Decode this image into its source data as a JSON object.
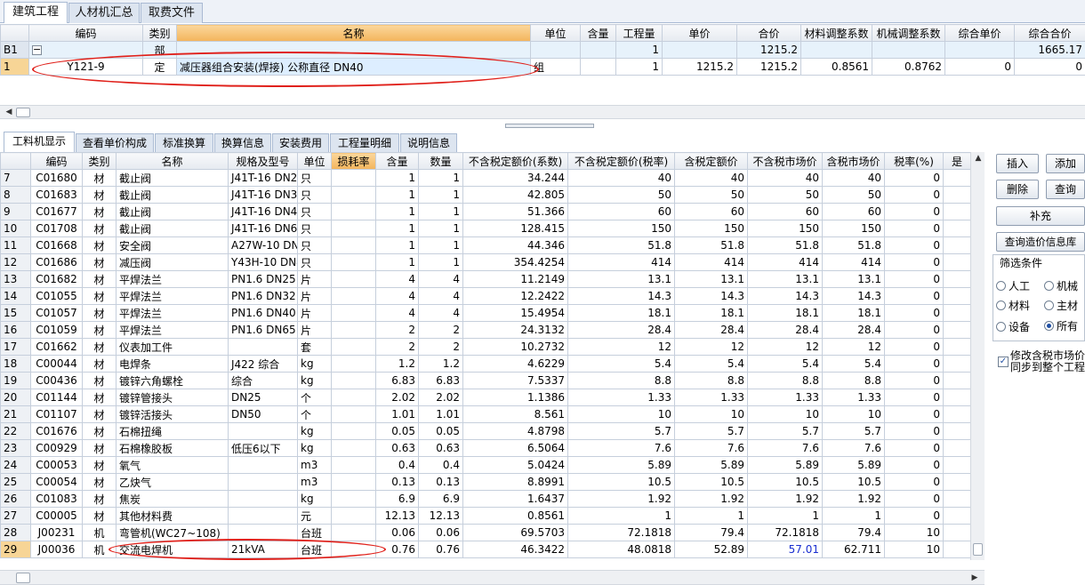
{
  "top_tabs": [
    "建筑工程",
    "人材机汇总",
    "取费文件"
  ],
  "upper_table": {
    "headers": [
      "编码",
      "类别",
      "名称",
      "单位",
      "含量",
      "工程量",
      "单价",
      "合价",
      "材料调整系数",
      "机械调整系数",
      "综合单价",
      "综合合价"
    ],
    "rows": [
      {
        "rh": "B1",
        "code": "",
        "type": "部",
        "name": "",
        "unit": "",
        "content": "",
        "qty": "1",
        "price": "",
        "total": "1215.2",
        "mat_coef": "",
        "mach_coef": "",
        "unit_total": "",
        "sum_total": "1665.17"
      },
      {
        "rh": "1",
        "code": "Y121-9",
        "type": "定",
        "name": "减压器组合安装(焊接) 公称直径 DN40",
        "unit": "组",
        "content": "",
        "qty": "1",
        "price": "1215.2",
        "total": "1215.2",
        "mat_coef": "0.8561",
        "mach_coef": "0.8762",
        "unit_total": "0",
        "sum_total": "0"
      }
    ],
    "expander_symbol": "−"
  },
  "bottom_tabs": [
    "工料机显示",
    "查看单价构成",
    "标准换算",
    "换算信息",
    "安装费用",
    "工程量明细",
    "说明信息"
  ],
  "lower_table": {
    "headers": [
      "编码",
      "类别",
      "名称",
      "规格及型号",
      "单位",
      "损耗率",
      "含量",
      "数量",
      "不含税定额价(系数)",
      "不含税定额价(税率)",
      "含税定额价",
      "不含税市场价",
      "含税市场价",
      "税率(%)",
      "是"
    ],
    "rows": [
      [
        "7",
        "C01680",
        "材",
        "截止阀",
        "J41T-16 DN2",
        "只",
        "",
        "1",
        "1",
        "34.244",
        "40",
        "40",
        "40",
        "40",
        "0"
      ],
      [
        "8",
        "C01683",
        "材",
        "截止阀",
        "J41T-16 DN3",
        "只",
        "",
        "1",
        "1",
        "42.805",
        "50",
        "50",
        "50",
        "50",
        "0"
      ],
      [
        "9",
        "C01677",
        "材",
        "截止阀",
        "J41T-16 DN4",
        "只",
        "",
        "1",
        "1",
        "51.366",
        "60",
        "60",
        "60",
        "60",
        "0"
      ],
      [
        "10",
        "C01708",
        "材",
        "截止阀",
        "J41T-16 DN6",
        "只",
        "",
        "1",
        "1",
        "128.415",
        "150",
        "150",
        "150",
        "150",
        "0"
      ],
      [
        "11",
        "C01668",
        "材",
        "安全阀",
        "A27W-10 DN4",
        "只",
        "",
        "1",
        "1",
        "44.346",
        "51.8",
        "51.8",
        "51.8",
        "51.8",
        "0"
      ],
      [
        "12",
        "C01686",
        "材",
        "减压阀",
        "Y43H-10 DN4",
        "只",
        "",
        "1",
        "1",
        "354.4254",
        "414",
        "414",
        "414",
        "414",
        "0"
      ],
      [
        "13",
        "C01682",
        "材",
        "平焊法兰",
        "PN1.6 DN25",
        "片",
        "",
        "4",
        "4",
        "11.2149",
        "13.1",
        "13.1",
        "13.1",
        "13.1",
        "0"
      ],
      [
        "14",
        "C01055",
        "材",
        "平焊法兰",
        "PN1.6 DN32",
        "片",
        "",
        "4",
        "4",
        "12.2422",
        "14.3",
        "14.3",
        "14.3",
        "14.3",
        "0"
      ],
      [
        "15",
        "C01057",
        "材",
        "平焊法兰",
        "PN1.6 DN40",
        "片",
        "",
        "4",
        "4",
        "15.4954",
        "18.1",
        "18.1",
        "18.1",
        "18.1",
        "0"
      ],
      [
        "16",
        "C01059",
        "材",
        "平焊法兰",
        "PN1.6 DN65",
        "片",
        "",
        "2",
        "2",
        "24.3132",
        "28.4",
        "28.4",
        "28.4",
        "28.4",
        "0"
      ],
      [
        "17",
        "C01662",
        "材",
        "仪表加工件",
        "",
        "套",
        "",
        "2",
        "2",
        "10.2732",
        "12",
        "12",
        "12",
        "12",
        "0"
      ],
      [
        "18",
        "C00044",
        "材",
        "电焊条",
        "J422 综合",
        "kg",
        "",
        "1.2",
        "1.2",
        "4.6229",
        "5.4",
        "5.4",
        "5.4",
        "5.4",
        "0"
      ],
      [
        "19",
        "C00436",
        "材",
        "镀锌六角螺栓",
        "综合",
        "kg",
        "",
        "6.83",
        "6.83",
        "7.5337",
        "8.8",
        "8.8",
        "8.8",
        "8.8",
        "0"
      ],
      [
        "20",
        "C01144",
        "材",
        "镀锌管接头",
        "DN25",
        "个",
        "",
        "2.02",
        "2.02",
        "1.1386",
        "1.33",
        "1.33",
        "1.33",
        "1.33",
        "0"
      ],
      [
        "21",
        "C01107",
        "材",
        "镀锌活接头",
        "DN50",
        "个",
        "",
        "1.01",
        "1.01",
        "8.561",
        "10",
        "10",
        "10",
        "10",
        "0"
      ],
      [
        "22",
        "C01676",
        "材",
        "石棉扭绳",
        "",
        "kg",
        "",
        "0.05",
        "0.05",
        "4.8798",
        "5.7",
        "5.7",
        "5.7",
        "5.7",
        "0"
      ],
      [
        "23",
        "C00929",
        "材",
        "石棉橡胶板",
        "低压6以下",
        "kg",
        "",
        "0.63",
        "0.63",
        "6.5064",
        "7.6",
        "7.6",
        "7.6",
        "7.6",
        "0"
      ],
      [
        "24",
        "C00053",
        "材",
        "氧气",
        "",
        "m3",
        "",
        "0.4",
        "0.4",
        "5.0424",
        "5.89",
        "5.89",
        "5.89",
        "5.89",
        "0"
      ],
      [
        "25",
        "C00054",
        "材",
        "乙炔气",
        "",
        "m3",
        "",
        "0.13",
        "0.13",
        "8.8991",
        "10.5",
        "10.5",
        "10.5",
        "10.5",
        "0"
      ],
      [
        "26",
        "C01083",
        "材",
        "焦炭",
        "",
        "kg",
        "",
        "6.9",
        "6.9",
        "1.6437",
        "1.92",
        "1.92",
        "1.92",
        "1.92",
        "0"
      ],
      [
        "27",
        "C00005",
        "材",
        "其他材料费",
        "",
        "元",
        "",
        "12.13",
        "12.13",
        "0.8561",
        "1",
        "1",
        "1",
        "1",
        "0"
      ],
      [
        "28",
        "J00231",
        "机",
        "弯管机(WC27~108)",
        "",
        "台班",
        "",
        "0.06",
        "0.06",
        "69.5703",
        "72.1818",
        "79.4",
        "72.1818",
        "79.4",
        "10"
      ],
      [
        "29",
        "J00036",
        "机",
        "交流电焊机",
        "21kVA",
        "台班",
        "",
        "0.76",
        "0.76",
        "46.3422",
        "48.0818",
        "52.89",
        "57.01",
        "62.711",
        "10"
      ]
    ]
  },
  "side_buttons": {
    "insert": "插入",
    "add": "添加",
    "delete": "删除",
    "query": "查询",
    "supplement": "补充",
    "query_price_lib": "查询造价信息库"
  },
  "filter": {
    "title": "筛选条件",
    "options": [
      "人工",
      "机械",
      "材料",
      "主材",
      "设备",
      "所有"
    ],
    "selected": "所有"
  },
  "sync_checkbox": {
    "checked": true,
    "line1": "修改含税市场价",
    "line2": "同步到整个工程"
  },
  "colors": {
    "highlight_header": "#f3b45c",
    "annotation": "#e0201a",
    "blue_value": "#1a2fd0"
  }
}
